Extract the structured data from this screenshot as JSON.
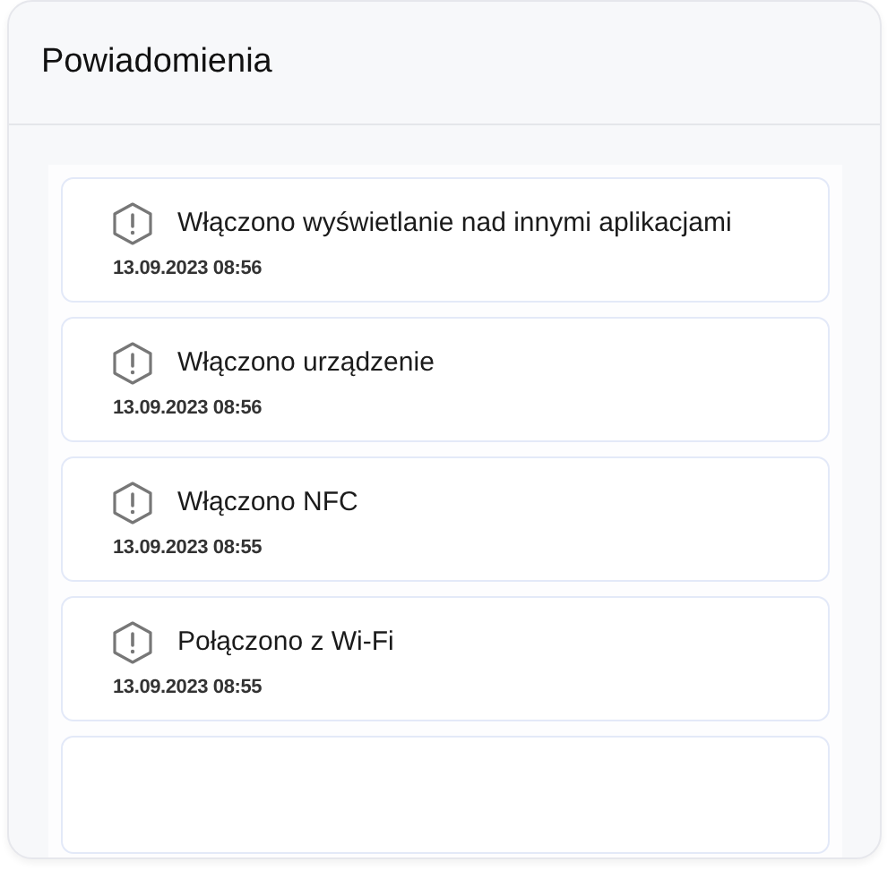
{
  "title": "Powiadomienia",
  "notifications": [
    {
      "message": "Włączono wyświetlanie nad innymi aplikacjami",
      "time": "13.09.2023 08:56"
    },
    {
      "message": "Włączono urządzenie",
      "time": "13.09.2023 08:56"
    },
    {
      "message": "Włączono NFC",
      "time": "13.09.2023 08:55"
    },
    {
      "message": "Połączono z Wi-Fi",
      "time": "13.09.2023 08:55"
    }
  ]
}
